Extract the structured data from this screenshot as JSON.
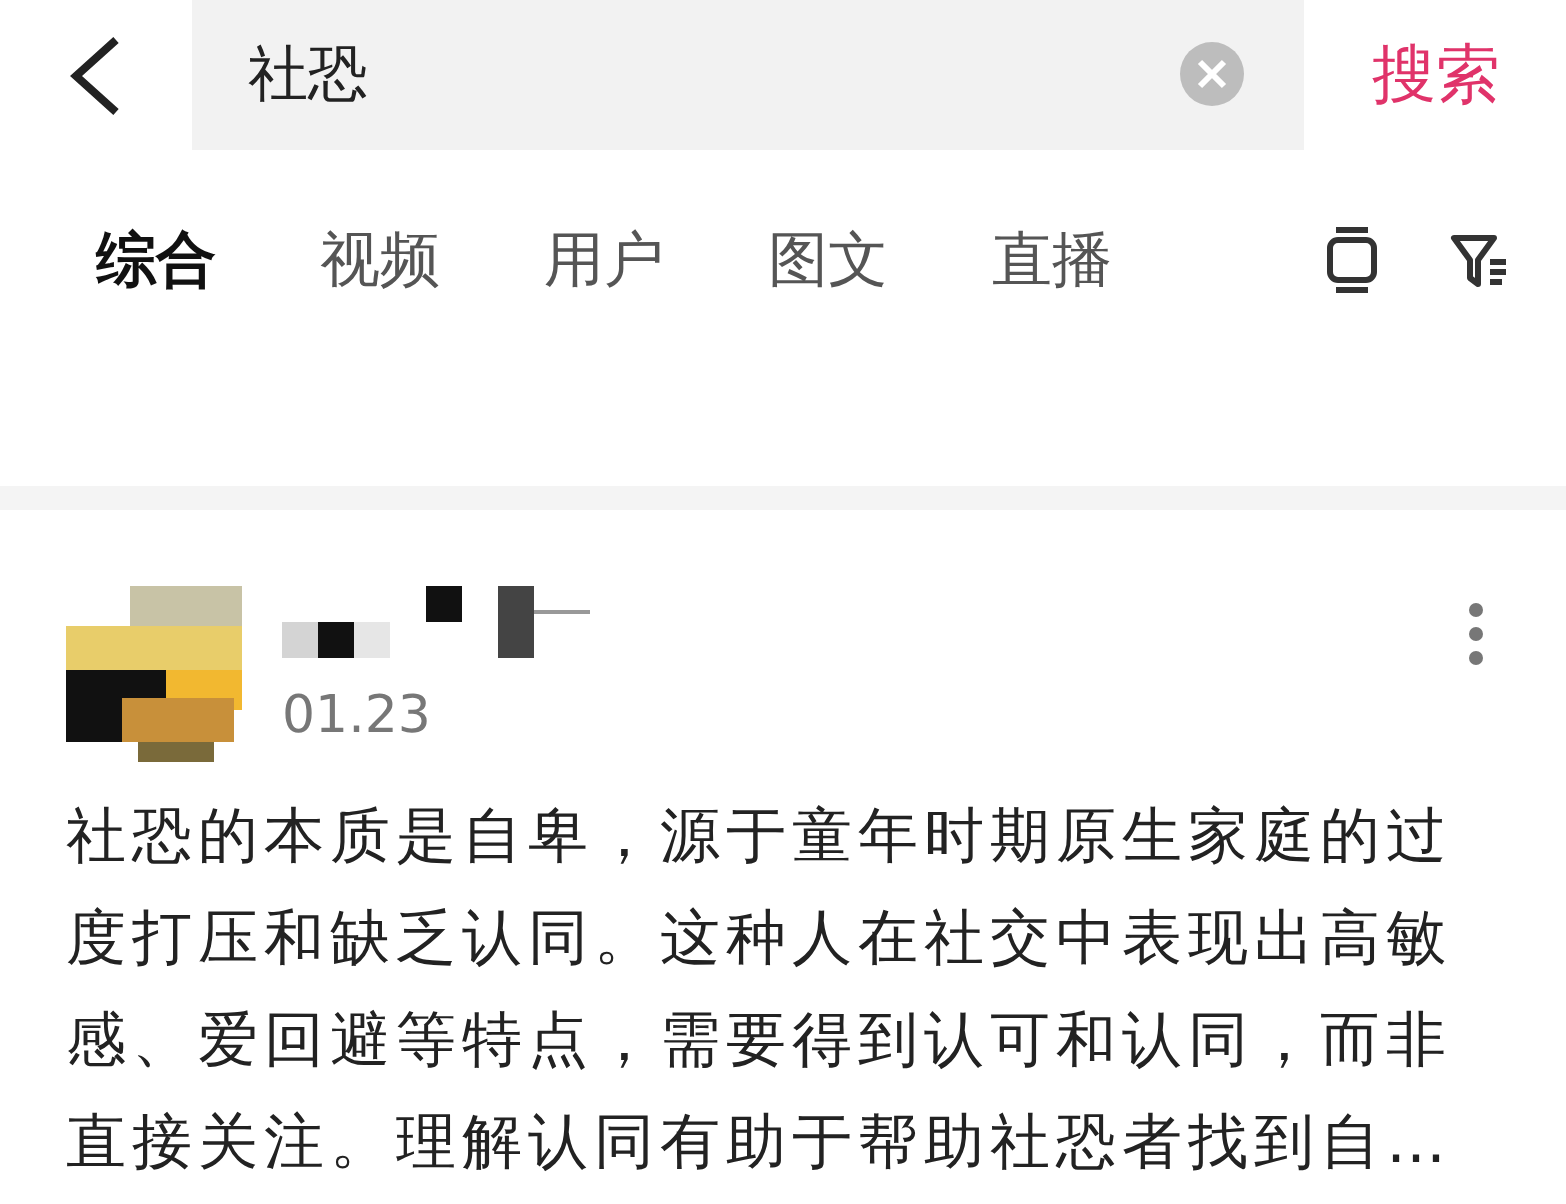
{
  "search": {
    "value": "社恐",
    "button": "搜索"
  },
  "tabs": [
    {
      "label": "综合",
      "selected": true
    },
    {
      "label": "视频",
      "selected": false
    },
    {
      "label": "用户",
      "selected": false
    },
    {
      "label": "图文",
      "selected": false
    },
    {
      "label": "直播",
      "selected": false
    }
  ],
  "post": {
    "date": "01.23",
    "text": "社恐的本质是自卑，源于童年时期原生家庭的过度打压和缺乏认同。这种人在社交中表现出高敏感、爱回避等特点，需要得到认可和认同，而非直接关注。理解认同有助于帮助社恐者找到自…"
  }
}
